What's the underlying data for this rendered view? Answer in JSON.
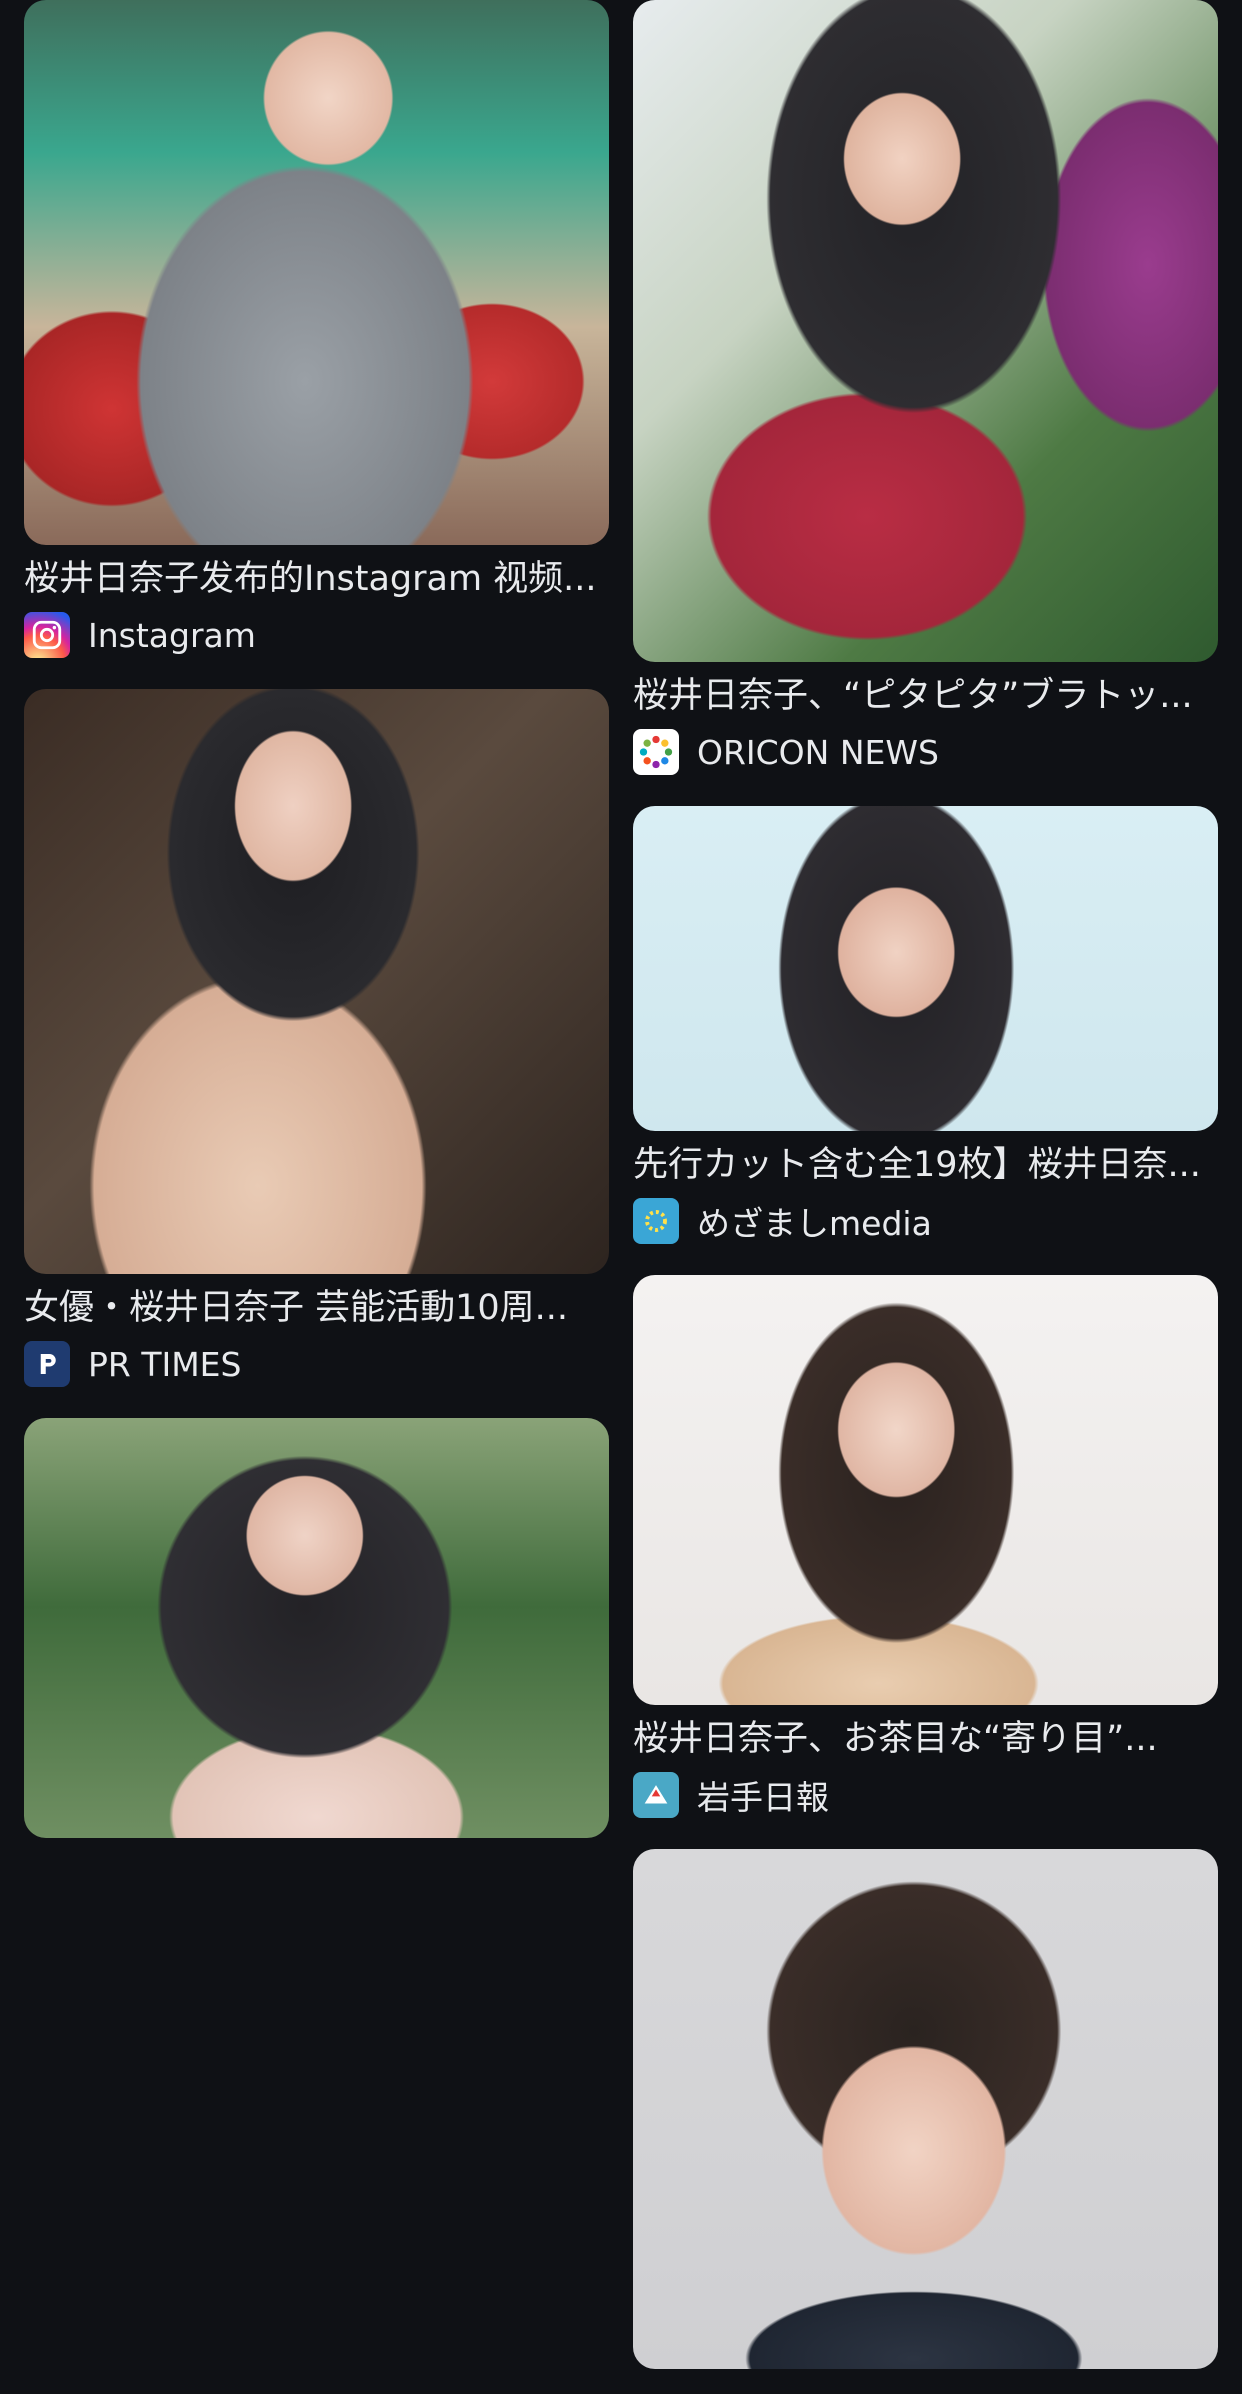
{
  "results": {
    "left": [
      {
        "title": "桜井日奈子发布的Instagram 视频...",
        "source": "Instagram",
        "icon": "instagram-icon"
      },
      {
        "title": "女優・桜井日奈子 芸能活動10周...",
        "source": "PR TIMES",
        "icon": "prtimes-icon"
      },
      {
        "title": "",
        "source": "",
        "icon": ""
      }
    ],
    "right": [
      {
        "title": "桜井日奈子、“ピタピタ”ブラトッ...",
        "source": "ORICON NEWS",
        "icon": "oricon-icon"
      },
      {
        "title": "先行カット含む全19枚】桜井日奈...",
        "source": "めざましmedia",
        "icon": "mezamashi-icon"
      },
      {
        "title": "桜井日奈子、お茶目な“寄り目”...",
        "source": "岩手日報",
        "icon": "iwate-nippo-icon"
      },
      {
        "title": "",
        "source": "",
        "icon": ""
      }
    ]
  },
  "colors": {
    "background": "#0f1115",
    "text": "#e8eaed",
    "instagram": "#e1306c",
    "prtimes": "#1f3b70",
    "mezamashi": "#3aa6d6",
    "iwate": "#4aa8c6"
  }
}
